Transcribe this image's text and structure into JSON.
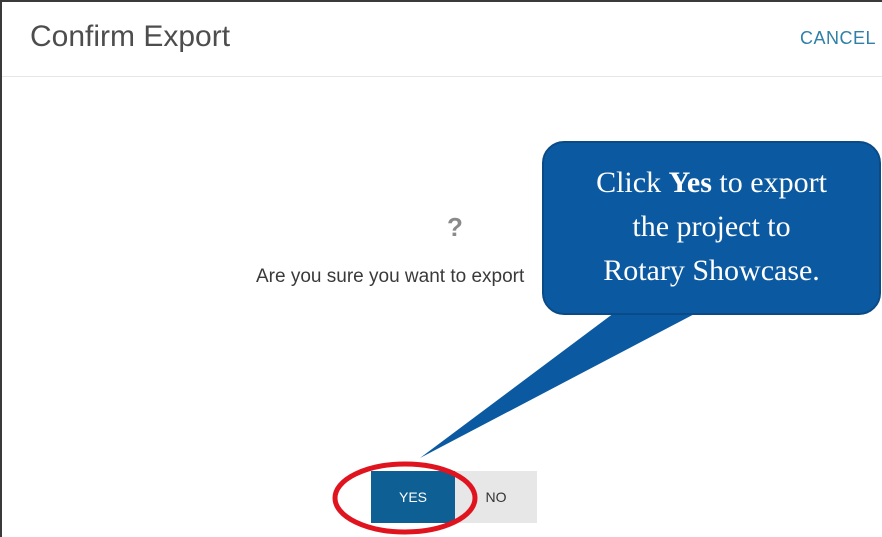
{
  "dialog": {
    "title": "Confirm Export",
    "cancel_label": "CANCEL",
    "icon_glyph": "?",
    "message": "Are you sure you want to export"
  },
  "buttons": {
    "yes_label": "YES",
    "no_label": "NO"
  },
  "callout": {
    "prefix": "Click ",
    "bold": "Yes",
    "suffix": " to export",
    "line2": "the project to",
    "line3": "Rotary Showcase."
  },
  "colors": {
    "accent": "#0e5f94",
    "callout_bg": "#0b5aa1",
    "highlight_ring": "#e0141e",
    "cancel_link": "#2f80a8"
  }
}
